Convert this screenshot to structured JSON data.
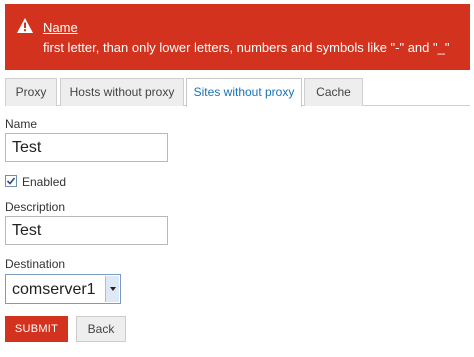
{
  "alert": {
    "title": "Name",
    "message": "first letter, than only lower letters, numbers and symbols like \"-\" and \"_\"",
    "icon": "warning-icon",
    "color": "#d2321e"
  },
  "tabs": [
    {
      "label": "Proxy",
      "active": false
    },
    {
      "label": "Hosts without proxy",
      "active": false
    },
    {
      "label": "Sites without proxy",
      "active": true
    },
    {
      "label": "Cache",
      "active": false
    }
  ],
  "form": {
    "name_label": "Name",
    "name_value": "Test",
    "enabled_label": "Enabled",
    "enabled_checked": true,
    "description_label": "Description",
    "description_value": "Test",
    "destination_label": "Destination",
    "destination_value": "comserver1"
  },
  "buttons": {
    "submit_label": "SUBMIT",
    "back_label": "Back"
  }
}
